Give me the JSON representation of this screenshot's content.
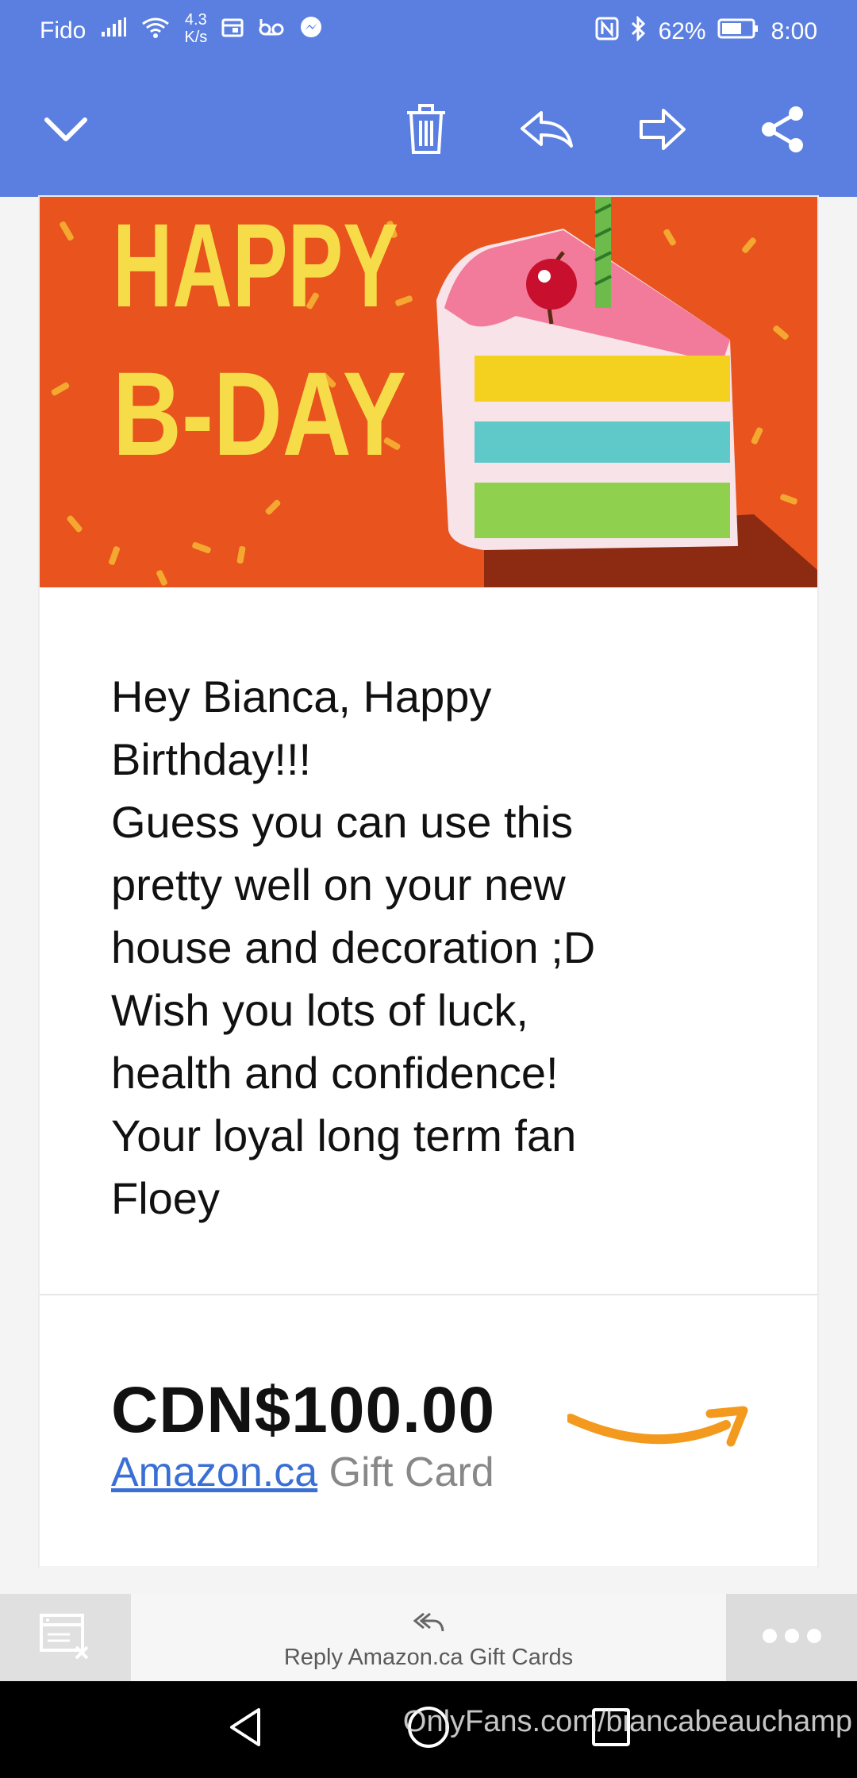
{
  "status_bar": {
    "carrier": "Fido",
    "net_speed_value": "4.3",
    "net_speed_unit": "K/s",
    "battery": "62%",
    "time": "8:00",
    "icons": [
      "signal-icon",
      "wifi-icon",
      "calendar-icon",
      "voicemail-icon",
      "messenger-icon",
      "nfc-icon",
      "bluetooth-icon",
      "battery-icon"
    ]
  },
  "toolbar": {
    "icons": [
      "chevron-down-icon",
      "trash-icon",
      "reply-icon",
      "forward-icon",
      "share-icon"
    ]
  },
  "email": {
    "banner_text_line1": "HAPPY",
    "banner_text_line2": "B-DAY",
    "message": "Hey Bianca, Happy\nBirthday!!!\nGuess you can use this\npretty well on your new\nhouse and decoration ;D\nWish you lots of luck,\nhealth and confidence!\nYour loyal long term fan\nFloey",
    "amount": "CDN$100.00",
    "link_text": "Amazon.ca",
    "gift_card_text": " Gift Card",
    "colors": {
      "banner_orange": "#e8531e",
      "banner_yellow": "#f7dc4a",
      "amazon_orange": "#f39a1e",
      "link_blue": "#3a6fd4"
    }
  },
  "reply_bar": {
    "reply_label": "Reply Amazon.ca Gift Cards",
    "icons": [
      "block-sender-icon",
      "reply-all-icon",
      "more-icon"
    ]
  },
  "nav_bar": {
    "icons": [
      "back-icon",
      "home-icon",
      "recents-icon"
    ]
  },
  "watermark": "OnlyFans.com/biancabeauchamp",
  "colors": {
    "appbar_blue": "#5a7fe0"
  }
}
